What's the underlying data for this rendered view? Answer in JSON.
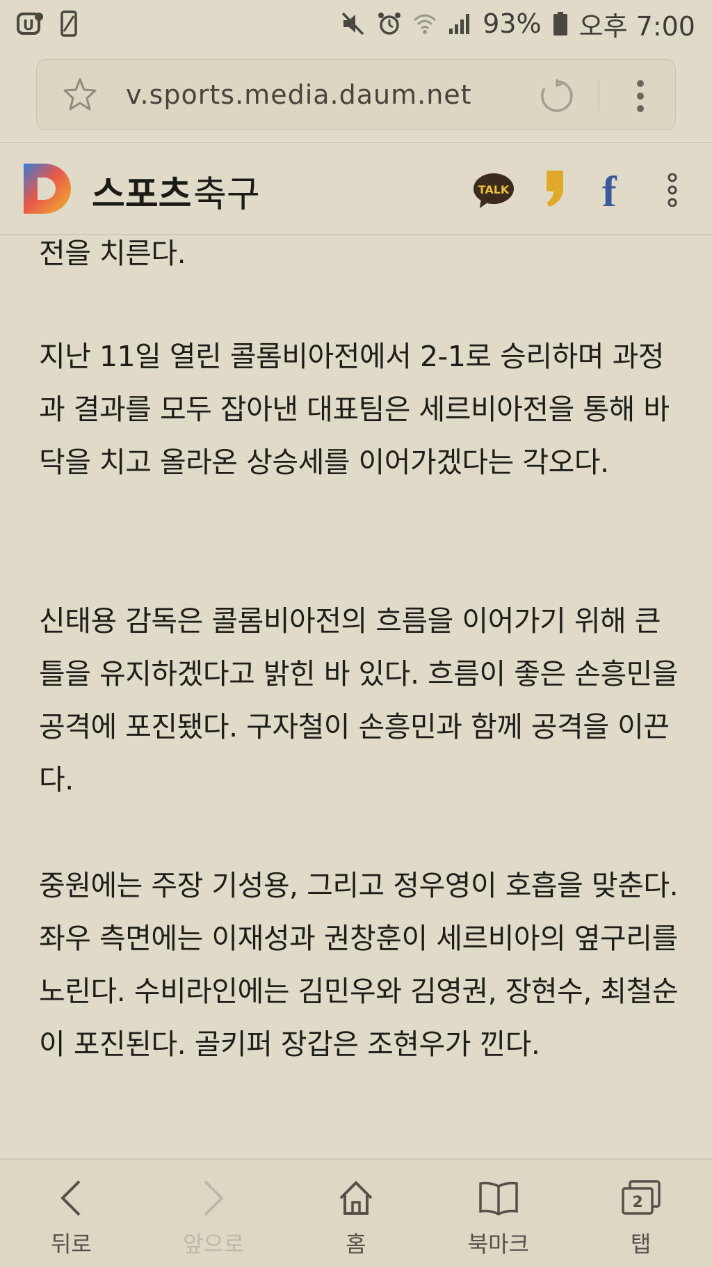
{
  "status_bar": {
    "battery": "93%",
    "time": "오후 7:00"
  },
  "browser": {
    "url": "v.sports.media.daum.net"
  },
  "site_header": {
    "title": "스포츠",
    "section": "축구",
    "kakao_talk_label": "TALK"
  },
  "article": {
    "paragraphs": [
      "전을 치른다.",
      "지난 11일 열린 콜롬비아전에서 2-1로 승리하며 과정과 결과를 모두 잡아낸 대표팀은 세르비아전을 통해 바닥을 치고 올라온 상승세를 이어가겠다는 각오다.",
      "신태용 감독은 콜롬비아전의 흐름을 이어가기 위해 큰 틀을 유지하겠다고 밝힌 바 있다. 흐름이 좋은 손흥민을 공격에 포진됐다. 구자철이 손흥민과 함께 공격을 이끈다.",
      "중원에는 주장 기성용, 그리고 정우영이 호흡을 맞춘다. 좌우 측면에는 이재성과 권창훈이 세르비아의 옆구리를 노린다. 수비라인에는 김민우와 김영권, 장현수, 최철순이 포진된다. 골키퍼 장갑은 조현우가 낀다."
    ]
  },
  "bottom_nav": {
    "items": [
      {
        "label": "뒤로",
        "icon": "back-icon",
        "enabled": true
      },
      {
        "label": "앞으로",
        "icon": "forward-icon",
        "enabled": false
      },
      {
        "label": "홈",
        "icon": "home-icon",
        "enabled": true
      },
      {
        "label": "북마크",
        "icon": "bookmark-icon",
        "enabled": true
      },
      {
        "label": "탭",
        "icon": "tabs-icon",
        "enabled": true,
        "tab_count": "2"
      }
    ]
  },
  "colors": {
    "background": "#e0dbc9",
    "text": "#1f1d19",
    "facebook": "#3c5a9a",
    "kakao": "#3b2a1d",
    "comma": "#e0a92a"
  }
}
